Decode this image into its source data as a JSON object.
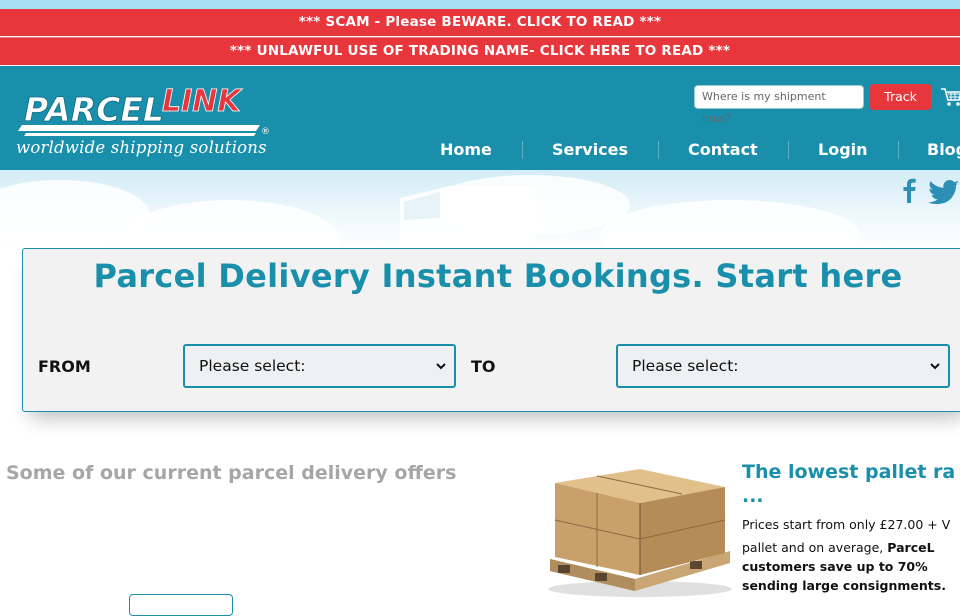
{
  "banners": {
    "scam": "*** SCAM - Please BEWARE. CLICK TO READ ***",
    "unlawful": "*** UNLAWFUL USE OF TRADING NAME- CLICK HERE TO READ ***"
  },
  "header": {
    "logo_text_1": "PARCEL",
    "logo_text_2": "LINK",
    "logo_mark": "®",
    "tagline": "worldwide shipping solutions",
    "search_placeholder": "Where is my shipment now?",
    "track_label": "Track",
    "cart_icon": "cart-icon"
  },
  "nav": {
    "items": [
      {
        "label": "Home"
      },
      {
        "label": "Services"
      },
      {
        "label": "Contact"
      },
      {
        "label": "Login"
      },
      {
        "label": "Blog"
      }
    ]
  },
  "social": {
    "facebook_icon": "facebook-icon",
    "twitter_icon": "twitter-icon"
  },
  "booking": {
    "title": "Parcel Delivery Instant Bookings. Start here",
    "from_label": "FROM",
    "to_label": "TO",
    "from_value": "Please select:",
    "to_value": "Please select:"
  },
  "offers": {
    "heading": "Some of our current parcel delivery offers"
  },
  "pallet": {
    "title": "The lowest pallet ra",
    "dots": "...",
    "line1": "Prices start from only £27.00 + V",
    "line2_a": "pallet and on average,",
    "line2_b": "ParceL",
    "line3": "customers save up to 70%",
    "line4": "sending large consignments."
  },
  "colors": {
    "brand_teal": "#1a8fab",
    "alert_red": "#e8363d",
    "panel_gray": "#f2f2f2"
  }
}
